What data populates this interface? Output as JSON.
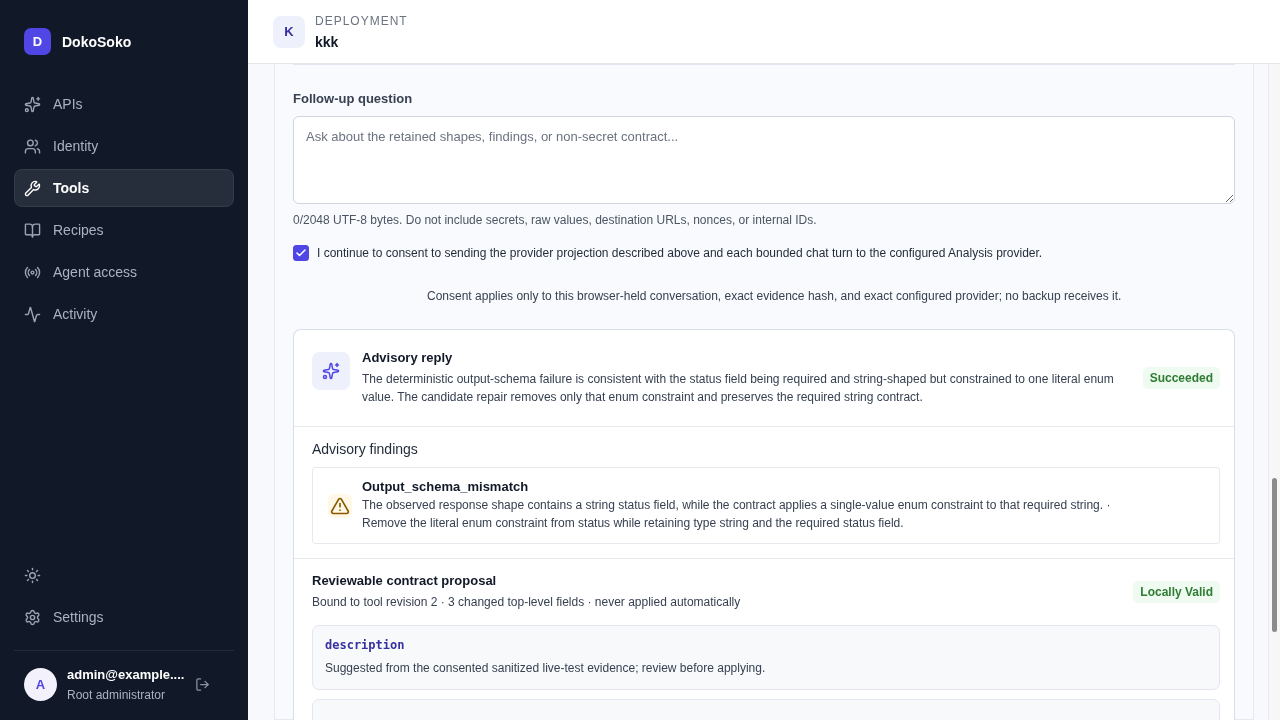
{
  "sidebar": {
    "brand": {
      "initial": "D",
      "name": "DokoSoko"
    },
    "items": [
      {
        "label": "APIs",
        "selected": false
      },
      {
        "label": "Identity",
        "selected": false
      },
      {
        "label": "Tools",
        "selected": true
      },
      {
        "label": "Recipes",
        "selected": false
      },
      {
        "label": "Agent access",
        "selected": false
      },
      {
        "label": "Activity",
        "selected": false
      }
    ],
    "settings": {
      "label": "Settings"
    },
    "user": {
      "initial": "A",
      "name": "admin@example....",
      "role": "Root administrator"
    }
  },
  "header": {
    "initial": "K",
    "eyebrow": "DEPLOYMENT",
    "title": "kkk"
  },
  "followup": {
    "label": "Follow-up question",
    "placeholder": "Ask about the retained shapes, findings, or non-secret contract...",
    "hint": "0/2048 UTF-8 bytes. Do not include secrets, raw values, destination URLs, nonces, or internal IDs.",
    "consent": {
      "checked": true,
      "label": "I continue to consent to sending the provider projection described above and each bounded chat turn to the configured Analysis provider."
    },
    "note": "Consent applies only to this browser-held conversation, exact evidence hash, and exact configured provider; no backup receives it."
  },
  "reply": {
    "title": "Advisory reply",
    "text": "The deterministic output-schema failure is consistent with the status field being required and string-shaped but constrained to one literal enum value. The candidate repair removes only that enum constraint and preserves the required string contract.",
    "status": "Succeeded"
  },
  "findings": {
    "title": "Advisory findings",
    "items": [
      {
        "title": "Output_schema_mismatch",
        "text": "The observed response shape contains a string status field, while the contract applies a single-value enum constraint to that required string. ·",
        "fix": "Remove the literal enum constraint from status while retaining type string and the required status field."
      }
    ]
  },
  "proposal": {
    "title": "Reviewable contract proposal",
    "subtitle": "Bound to tool revision 2 · 3 changed top-level fields · never applied automatically",
    "status": "Locally Valid",
    "fields": [
      {
        "name": "description",
        "text": "Suggested from the consented sanitized live-test evidence; review before applying."
      }
    ]
  }
}
